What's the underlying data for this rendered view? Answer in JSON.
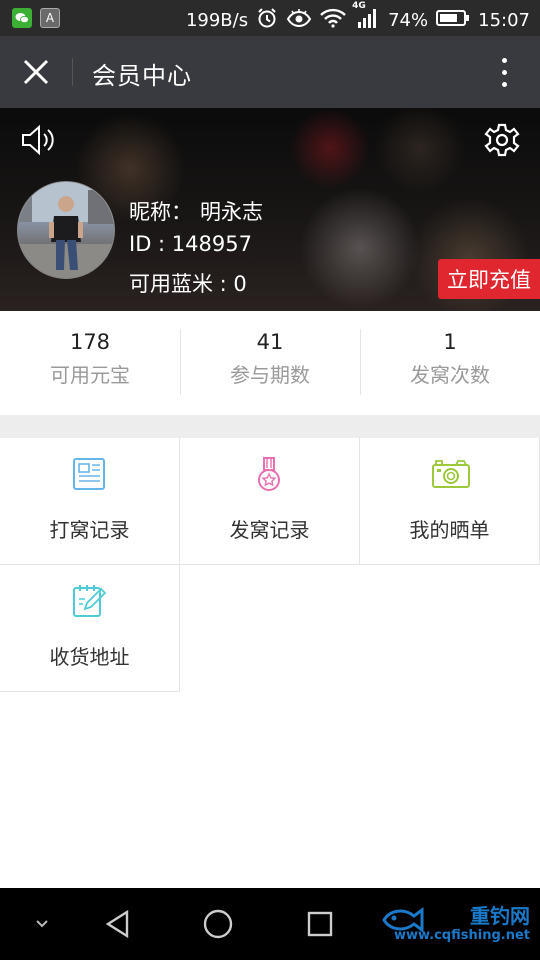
{
  "status_bar": {
    "network_speed": "199B/s",
    "network_type": "4G",
    "battery": "74%",
    "time": "15:07",
    "icons": [
      "wechat-icon",
      "a-app-icon",
      "alarm-icon",
      "eye-icon",
      "wifi-icon",
      "signal-icon",
      "battery-icon"
    ]
  },
  "header": {
    "title": "会员中心",
    "close_icon": "close-icon",
    "more_icon": "more-vertical-icon"
  },
  "profile": {
    "nickname_label": "昵称：",
    "nickname": "明永志",
    "id_text": "ID : 148957",
    "balance_text": "可用蓝米 : 0",
    "recharge_label": "立即充值",
    "recharge_color": "#e0272f"
  },
  "stats": [
    {
      "value": "178",
      "label": "可用元宝"
    },
    {
      "value": "41",
      "label": "参与期数"
    },
    {
      "value": "1",
      "label": "发窝次数"
    }
  ],
  "menu": [
    {
      "label": "打窝记录",
      "icon": "document-list-icon",
      "color": "#66b5ea"
    },
    {
      "label": "发窝记录",
      "icon": "medal-icon",
      "color": "#e96fb1"
    },
    {
      "label": "我的晒单",
      "icon": "camera-icon",
      "color": "#9cc93a"
    },
    {
      "label": "收货地址",
      "icon": "edit-note-icon",
      "color": "#4ecbd6"
    }
  ],
  "nav": {
    "watermark_name": "重钓网",
    "watermark_url": "www.cqfishing.net"
  }
}
